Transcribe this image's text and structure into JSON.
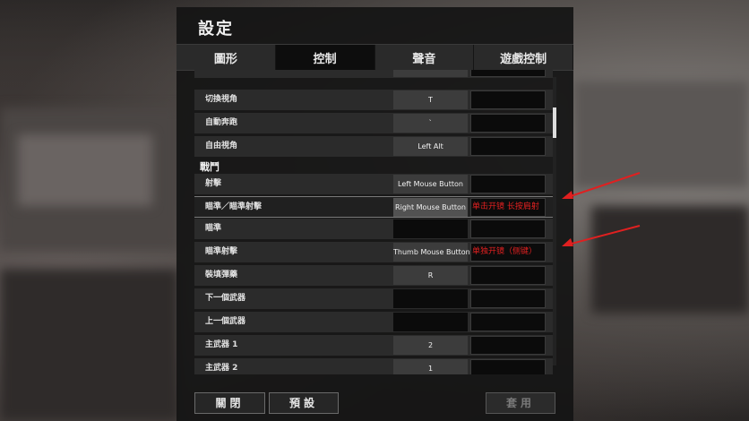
{
  "window": {
    "title": "設定"
  },
  "tabs": [
    {
      "label": "圖形",
      "active": false
    },
    {
      "label": "控制",
      "active": true
    },
    {
      "label": "聲音",
      "active": false
    },
    {
      "label": "遊戲控制",
      "active": false
    }
  ],
  "bindings": [
    {
      "label": "切換視角",
      "key": "T",
      "alt": ""
    },
    {
      "label": "自動奔跑",
      "key": "`",
      "alt": ""
    },
    {
      "label": "自由視角",
      "key": "Left Alt",
      "alt": ""
    }
  ],
  "section_combat": "戰鬥",
  "combat": [
    {
      "label": "射擊",
      "key": "Left Mouse Button",
      "alt": ""
    },
    {
      "label": "瞄準／瞄準射擊",
      "key": "Right Mouse Button",
      "alt": "单击开镜 长按肩射"
    },
    {
      "label": "瞄準",
      "key": "",
      "alt": ""
    },
    {
      "label": "瞄準射擊",
      "key": "Thumb Mouse Button 2",
      "alt": "单独开镜（侧键）"
    },
    {
      "label": "裝填彈藥",
      "key": "R",
      "alt": ""
    },
    {
      "label": "下一個武器",
      "key": "",
      "alt": ""
    },
    {
      "label": "上一個武器",
      "key": "",
      "alt": ""
    },
    {
      "label": "主武器 1",
      "key": "2",
      "alt": ""
    },
    {
      "label": "主武器 2",
      "key": "1",
      "alt": ""
    }
  ],
  "footer": {
    "close_label": "關閉",
    "default_label": "預設",
    "apply_label": "套用"
  },
  "colors": {
    "annotation_red": "#e02020",
    "panel_bg": "#141414"
  }
}
